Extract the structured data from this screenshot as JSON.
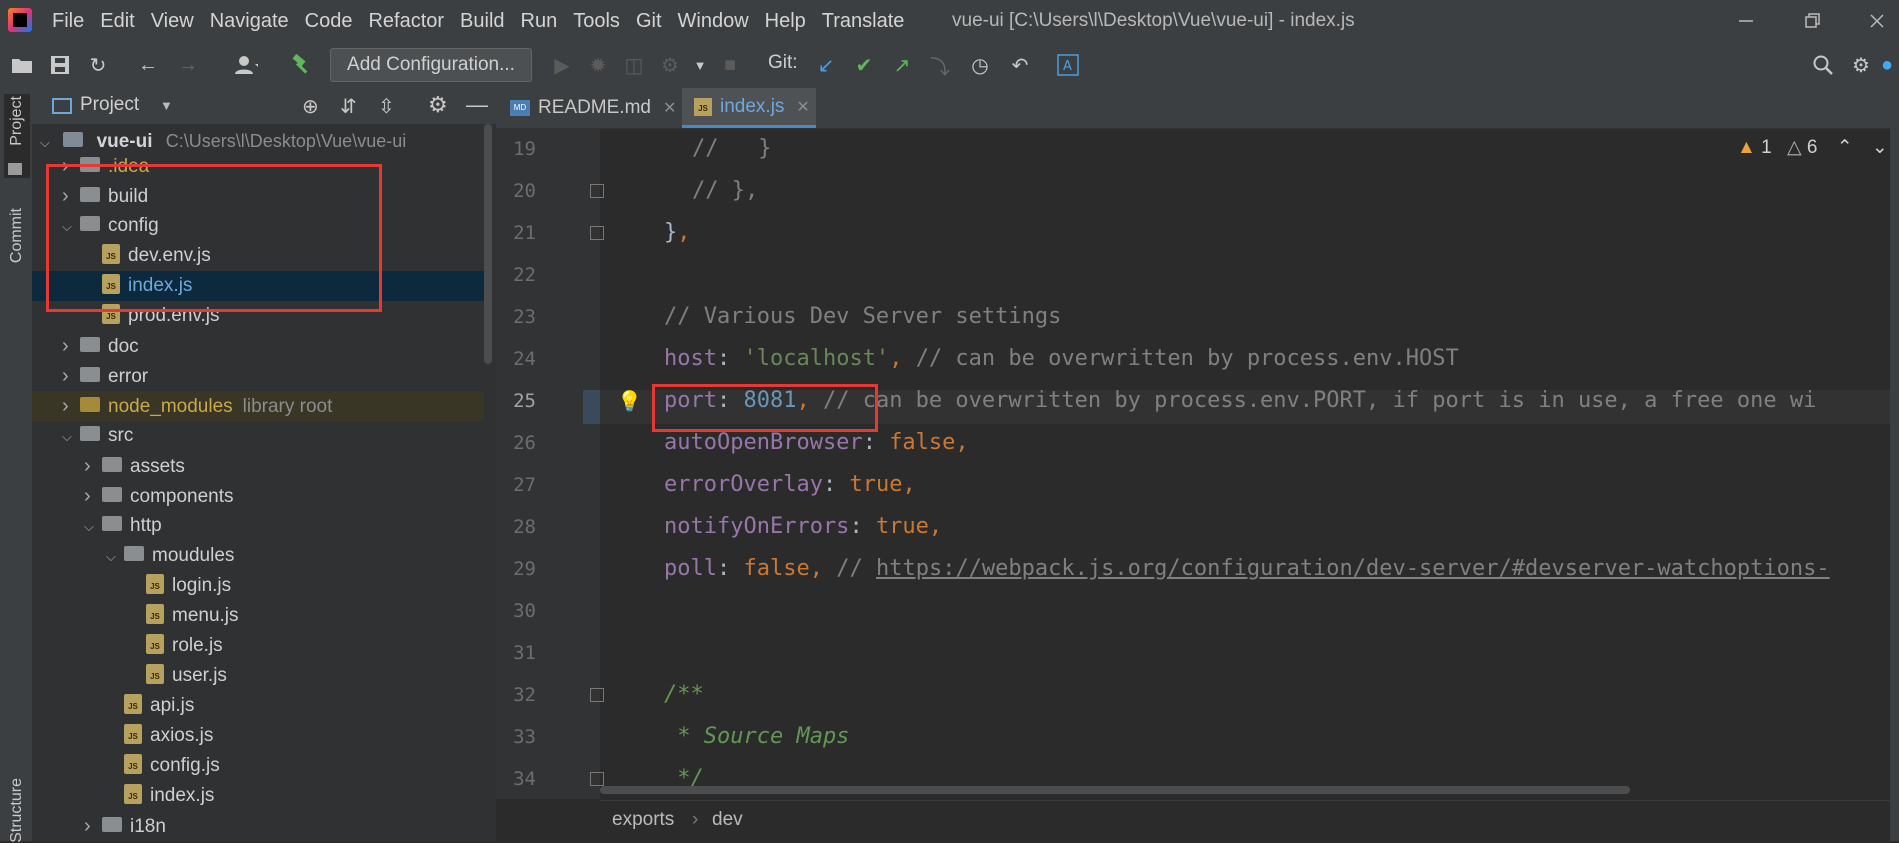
{
  "window": {
    "title": "vue-ui [C:\\Users\\l\\Desktop\\Vue\\vue-ui] - index.js"
  },
  "menu": [
    "File",
    "Edit",
    "View",
    "Navigate",
    "Code",
    "Refactor",
    "Build",
    "Run",
    "Tools",
    "Git",
    "Window",
    "Help",
    "Translate"
  ],
  "toolbar": {
    "add_configuration": "Add Configuration...",
    "git_label": "Git:"
  },
  "side_tabs": {
    "project": "Project",
    "commit": "Commit",
    "structure": "Structure"
  },
  "project_panel": {
    "title": "Project",
    "root_name": "vue-ui",
    "root_path": "C:\\Users\\l\\Desktop\\Vue\\vue-ui",
    "items": [
      {
        "name": ".idea",
        "type": "folder",
        "depth": 1,
        "expanded": false
      },
      {
        "name": "build",
        "type": "folder",
        "depth": 1,
        "expanded": false
      },
      {
        "name": "config",
        "type": "folder",
        "depth": 1,
        "expanded": true
      },
      {
        "name": "dev.env.js",
        "type": "js",
        "depth": 2
      },
      {
        "name": "index.js",
        "type": "js",
        "depth": 2,
        "selected": true
      },
      {
        "name": "prod.env.js",
        "type": "js",
        "depth": 2
      },
      {
        "name": "doc",
        "type": "folder",
        "depth": 1,
        "expanded": false
      },
      {
        "name": "error",
        "type": "folder",
        "depth": 1,
        "expanded": false
      },
      {
        "name": "node_modules",
        "type": "folder",
        "depth": 1,
        "expanded": false,
        "suffix": "library root"
      },
      {
        "name": "src",
        "type": "folder",
        "depth": 1,
        "expanded": true
      },
      {
        "name": "assets",
        "type": "folder",
        "depth": 2,
        "expanded": false
      },
      {
        "name": "components",
        "type": "folder",
        "depth": 2,
        "expanded": false
      },
      {
        "name": "http",
        "type": "folder",
        "depth": 2,
        "expanded": true
      },
      {
        "name": "moudules",
        "type": "folder",
        "depth": 3,
        "expanded": true
      },
      {
        "name": "login.js",
        "type": "js",
        "depth": 4
      },
      {
        "name": "menu.js",
        "type": "js",
        "depth": 4
      },
      {
        "name": "role.js",
        "type": "js",
        "depth": 4
      },
      {
        "name": "user.js",
        "type": "js",
        "depth": 4
      },
      {
        "name": "api.js",
        "type": "js",
        "depth": 3
      },
      {
        "name": "axios.js",
        "type": "js",
        "depth": 3
      },
      {
        "name": "config.js",
        "type": "js",
        "depth": 3
      },
      {
        "name": "index.js",
        "type": "js",
        "depth": 3
      },
      {
        "name": "i18n",
        "type": "folder",
        "depth": 2,
        "expanded": false
      }
    ]
  },
  "tabs": [
    {
      "label": "README.md",
      "icon": "MD"
    },
    {
      "label": "index.js",
      "icon": "JS",
      "active": true
    }
  ],
  "inspections": {
    "warnings": "1",
    "weak_warnings": "6"
  },
  "line_numbers": [
    "19",
    "20",
    "21",
    "22",
    "23",
    "24",
    "25",
    "26",
    "27",
    "28",
    "29",
    "30",
    "31",
    "32",
    "33",
    "34"
  ],
  "code_lines": {
    "l19": "//   }",
    "l20": "// },",
    "l21_brace": "}",
    "l21_comma": ",",
    "l23": "// Various Dev Server settings",
    "l24_key": "host",
    "l24_val": "'localhost'",
    "l24_comment": "// can be overwritten by process.env.HOST",
    "l25_key": "port",
    "l25_val": "8081",
    "l25_comment": "// can be overwritten by process.env.PORT, if port is in use, a free one wi",
    "l26_key": "autoOpenBrowser",
    "l26_val": "false",
    "l27_key": "errorOverlay",
    "l27_val": "true",
    "l28_key": "notifyOnErrors",
    "l28_val": "true",
    "l29_key": "poll",
    "l29_val": "false",
    "l29_comment": "// ",
    "l29_url": "https://webpack.js.org/configuration/dev-server/#devserver-watchoptions-",
    "l32": "/**",
    "l33": " * Source Maps",
    "l34": " */"
  },
  "breadcrumb": [
    "exports",
    "dev"
  ],
  "colors": {
    "highlight": "#e53935",
    "selection": "#0d293e"
  }
}
